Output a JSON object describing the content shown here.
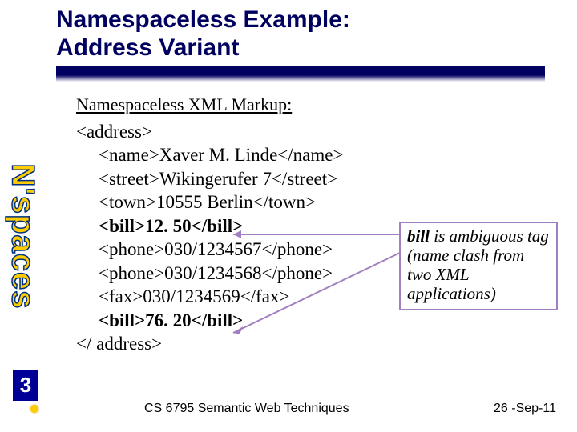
{
  "title_line1": "Namespaceless Example:",
  "title_line2": "Address Variant",
  "subhead": "Namespaceless XML Markup:",
  "code": {
    "l1": "<address>",
    "l2": "<name>Xaver M. Linde</name>",
    "l3": "<street>Wikingerufer 7</street>",
    "l4": "<town>10555 Berlin</town>",
    "l5": "<bill>12. 50</bill>",
    "l6": "<phone>030/1234567</phone>",
    "l7": "<phone>030/1234568</phone>",
    "l8": "<fax>030/1234569</fax>",
    "l9": "<bill>76. 20</bill>",
    "l10": "</ address>"
  },
  "annotation": {
    "keyword": "bill",
    "rest": " is ambiguous tag (name clash from two XML applications)"
  },
  "sidebar": "N'spaces",
  "slide_number": "3",
  "footer": "CS 6795 Semantic Web Techniques",
  "date": "26 -Sep-11"
}
